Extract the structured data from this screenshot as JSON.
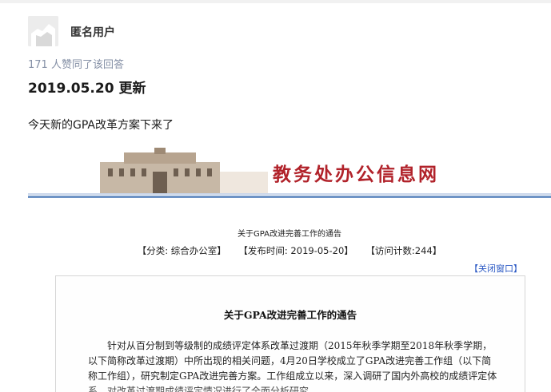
{
  "answer": {
    "author": "匿名用户",
    "votes": "171 人赞同了该回答",
    "update_heading": "2019.05.20 更新",
    "paragraph": "今天新的GPA改革方案下来了"
  },
  "screenshot": {
    "site_title": "教务处办公信息网",
    "notice_small_title": "关于GPA改进完善工作的通告",
    "meta": {
      "category": "【分类: 综合办公室】",
      "published": "【发布时间: 2019-05-20】",
      "visits": "【访问计数:244】"
    },
    "close_link": "【关闭窗口】",
    "notice_title": "关于GPA改进完善工作的通告",
    "body": "针对从百分制到等级制的成绩评定体系改革过渡期（2015年秋季学期至2018年秋季学期，以下简称改革过渡期）中所出现的相关问题，4月20日学校成立了GPA改进完善工作组（以下简称工作组），研究制定GPA改进完善方案。工作组成立以来，深入调研了国内外高校的成绩评定体系，对改革过渡期成绩评定情况进行了全面分析研究。"
  },
  "colors": {
    "accent_red": "#b1222a",
    "link_blue": "#2a58c4",
    "muted_gray": "#8590a6"
  }
}
